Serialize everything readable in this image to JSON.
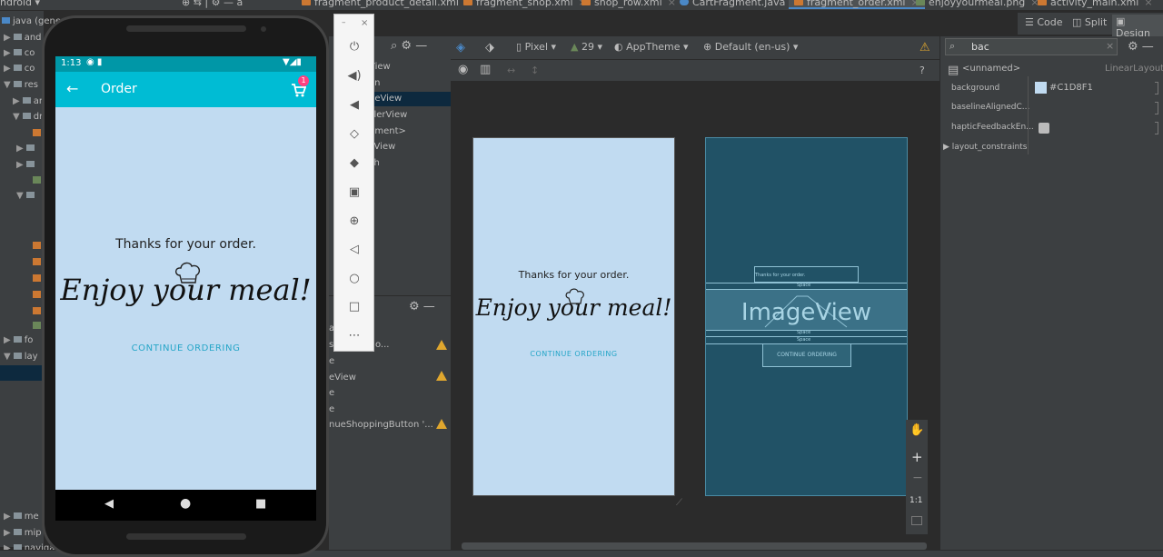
{
  "tabs": [
    {
      "label": "fragment_product_detail.xml"
    },
    {
      "label": "fragment_shop.xml"
    },
    {
      "label": "shop_row.xml"
    },
    {
      "label": "CartFragment.java"
    },
    {
      "label": "fragment_order.xml"
    },
    {
      "label": "enjoyyourmeal.png"
    },
    {
      "label": "activity_main.xml"
    }
  ],
  "view_modes": {
    "code": "Code",
    "split": "Split",
    "design": "Design"
  },
  "project": {
    "dropdown": "ndroid",
    "root": "java (gene",
    "items": [
      "and",
      "co",
      "co",
      "res",
      "an",
      "dr",
      "fo",
      "lay",
      "me",
      "mip",
      "naviga"
    ]
  },
  "palette_items": [
    "View",
    "on",
    "geView",
    "clerView",
    "gment>",
    "llView",
    "ch"
  ],
  "component_tree": [
    "al)",
    "s for your o...",
    "e",
    "eView",
    "e",
    "e",
    "nueShoppingButton  '..."
  ],
  "design_toolbar": {
    "device": "Pixel",
    "api": "29",
    "theme": "AppTheme",
    "locale": "Default (en-us)"
  },
  "design_preview": {
    "thanks": "Thanks for your order.",
    "enjoy": "Enjoy your meal!",
    "continue": "CONTINUE ORDERING"
  },
  "blueprint": {
    "thanks": "Thanks for your order.",
    "space": "Space",
    "imageview": "ImageView",
    "continue": "CONTINUE ORDERING"
  },
  "attributes": {
    "search": "bac",
    "header_name": "<unnamed>",
    "header_type": "LinearLayout",
    "rows": [
      {
        "key": "background",
        "value": "#C1D8F1"
      },
      {
        "key": "baselineAlignedC...",
        "value": ""
      },
      {
        "key": "hapticFeedbackEn...",
        "value": ""
      },
      {
        "key": "layout_constraints",
        "value": ""
      }
    ]
  },
  "zoom": {
    "ratio": "1:1"
  },
  "emulator": {
    "time": "1:13",
    "title": "Order",
    "cart_count": "1",
    "thanks": "Thanks for your order.",
    "enjoy": "Enjoy your meal!",
    "continue": "CONTINUE ORDERING"
  },
  "colors": {
    "accent": "#00bcd4",
    "status": "#0097a7",
    "background": "#c1dbf1",
    "link": "#26a6c8"
  }
}
